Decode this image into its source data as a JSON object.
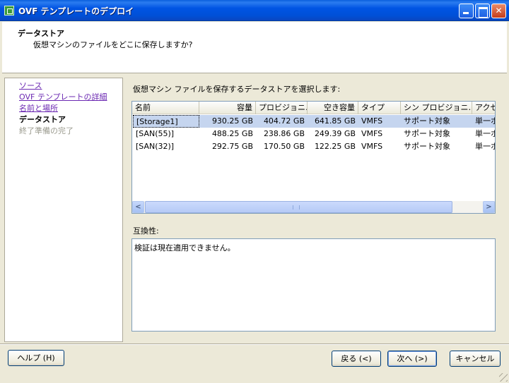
{
  "window": {
    "title": "OVF テンプレートのデプロイ"
  },
  "header": {
    "title": "データストア",
    "subtitle": "仮想マシンのファイルをどこに保存しますか?"
  },
  "nav": {
    "items": [
      {
        "label": "ソース",
        "state": "link"
      },
      {
        "label": "OVF テンプレートの詳細",
        "state": "link"
      },
      {
        "label": "名前と場所",
        "state": "link"
      },
      {
        "label": "データストア",
        "state": "current"
      },
      {
        "label": "終了準備の完了",
        "state": "disabled"
      }
    ]
  },
  "content": {
    "instruction": "仮想マシン ファイルを保存するデータストアを選択します:",
    "table": {
      "columns": [
        "名前",
        "容量",
        "プロビジョニ…",
        "空き容量",
        "タイプ",
        "シン プロビジョニ…",
        "アクセ"
      ],
      "rows": [
        [
          "[Storage1]",
          "930.25 GB",
          "404.72 GB",
          "641.85 GB",
          "VMFS",
          "サポート対象",
          "単一ホスト"
        ],
        [
          "[SAN(55)]",
          "488.25 GB",
          "238.86 GB",
          "249.39 GB",
          "VMFS",
          "サポート対象",
          "単一ホスト"
        ],
        [
          "[SAN(32)]",
          "292.75 GB",
          "170.50 GB",
          "122.25 GB",
          "VMFS",
          "サポート対象",
          "単一ホスト"
        ]
      ],
      "selected_row": 0
    },
    "compat_label": "互換性:",
    "compat_text": "検証は現在適用できません。"
  },
  "buttons": {
    "help": "ヘルプ (H)",
    "back": "戻る (<)",
    "next": "次へ (>)",
    "cancel": "キャンセル"
  },
  "colors": {
    "titlebar": "#0054e3",
    "selection": "#c5d5ef",
    "link": "#6b28b2"
  }
}
